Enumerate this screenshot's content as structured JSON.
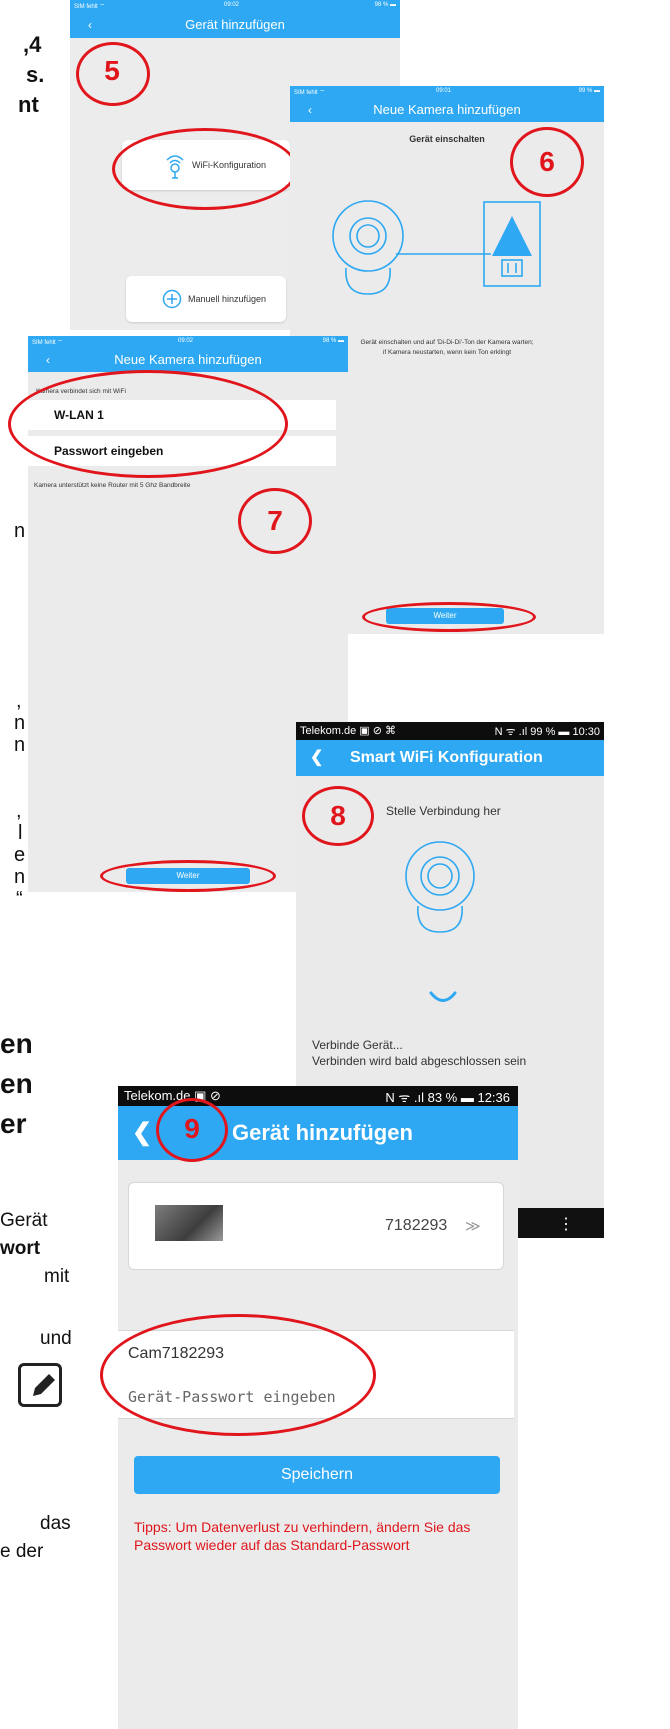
{
  "page": {
    "bg_fragments": [
      ",4",
      "s.",
      "nt",
      "n",
      ",",
      "n",
      "n",
      ",",
      "l",
      "e",
      "n",
      "“",
      "en",
      "en",
      "er",
      "Gerät",
      "wort",
      "mit",
      "und",
      "das",
      "e der"
    ]
  },
  "step_numbers": {
    "s5": "5",
    "s6": "6",
    "s7": "7",
    "s8": "8",
    "s9": "9"
  },
  "screen5": {
    "status_left": "SIM fehlt ⌔",
    "status_center": "09:02",
    "status_right": "98 % ▬",
    "back": "‹",
    "title": "Gerät hinzufügen",
    "wifi_button": "WiFi-Konfiguration",
    "manual_button": "Manuell hinzufügen"
  },
  "screen6": {
    "status_left": "SIM fehlt ⌔",
    "status_center": "09:01",
    "status_right": "99 % ▬",
    "back": "‹",
    "title": "Neue Kamera hinzufügen",
    "heading": "Gerät einschalten",
    "instruction_line1": "Gerät einschalten und auf 'Di-Di-Di'-Ton der Kamera warten;",
    "instruction_line2": "if Kamera neustarten, wenn kein Ton erklingt",
    "next_button": "Weiter"
  },
  "screen7": {
    "status_left": "SIM fehlt ⌔",
    "status_center": "09:02",
    "status_right": "98 % ▬",
    "back": "‹",
    "title": "Neue Kamera hinzufügen",
    "section_label": "Kamera verbindet sich mit WiFi",
    "wifi_name": "W-LAN 1",
    "password_placeholder": "Passwort eingeben",
    "note": "Kamera unterstützt keine Router mit 5 Ghz Bandbreite",
    "next_button": "Weiter"
  },
  "screen8": {
    "status_left": "Telekom.de ▣ ⊘ ⌘",
    "status_right": "N ᯤ .ıl 99 % ▬ 10:30",
    "back": "❮",
    "title": "Smart WiFi Konfiguration",
    "connecting_label": "Stelle Verbindung her",
    "progress_line1": "Verbinde Gerät...",
    "progress_line2": "Verbinden wird bald abgeschlossen sein",
    "menu": "⋮"
  },
  "screen9": {
    "status_left": "Telekom.de ▣ ⊘",
    "status_right": "N ᯤ .ıl 83 % ▬ 12:36",
    "back": "❮",
    "title": "Gerät hinzufügen",
    "device_id": "7182293",
    "device_chevron": "≫",
    "device_name": "Cam7182293",
    "password_placeholder": "Gerät-Passwort eingeben",
    "save_button": "Speichern",
    "tip_line1": "Tipps: Um Datenverlust zu verhindern, ändern Sie das",
    "tip_line2": "Passwort wieder auf das Standard-Passwort"
  },
  "colors": {
    "accent": "#2ea8f2",
    "annotation": "#e0161c"
  }
}
